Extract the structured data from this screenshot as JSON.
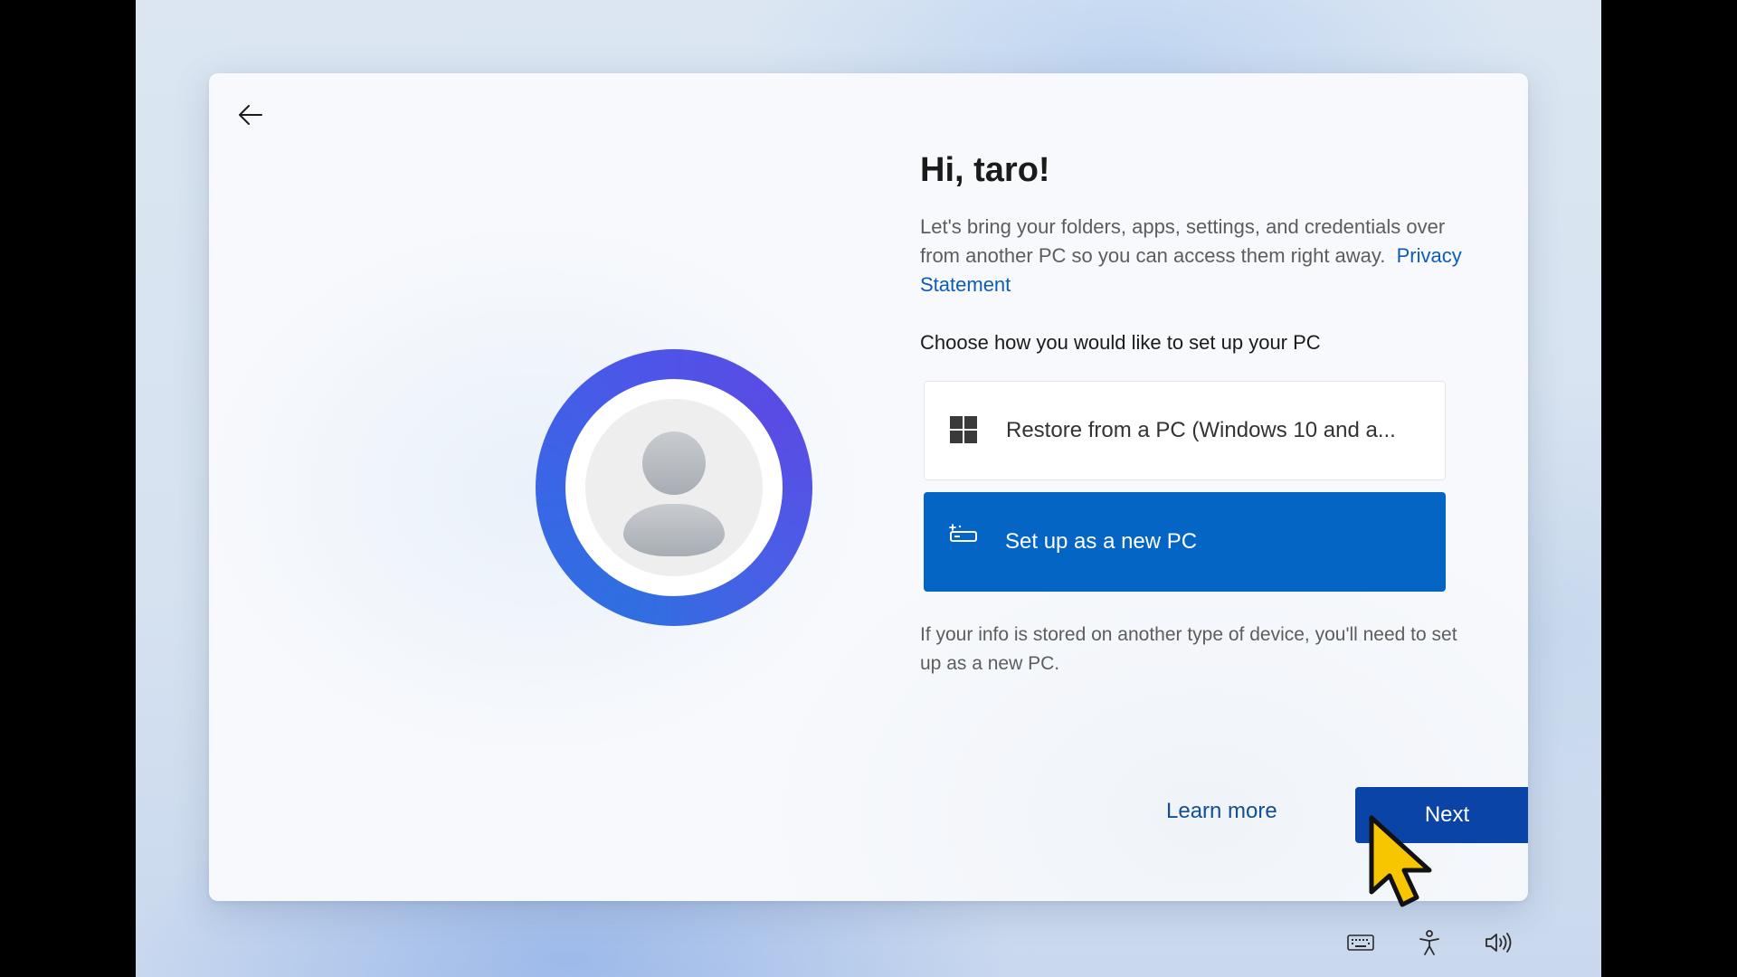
{
  "setup": {
    "greeting": "Hi, taro!",
    "description": "Let's bring your folders, apps, settings, and credentials over from another PC so you can access them right away.",
    "privacy_link": "Privacy Statement",
    "choose_prompt": "Choose how you would like to set up your PC",
    "options": [
      {
        "label": "Restore from a PC (Windows 10 and a...",
        "icon": "windows-logo-icon",
        "selected": false
      },
      {
        "label": "Set up as a new PC",
        "icon": "new-pc-icon",
        "selected": true
      }
    ],
    "info_text": "If your info is stored on another type of device, you'll need to set up as a new PC.",
    "learn_more": "Learn more",
    "next": "Next"
  },
  "tray": {
    "icons": [
      "keyboard-icon",
      "accessibility-icon",
      "volume-icon"
    ]
  },
  "colors": {
    "accent": "#0565c5",
    "next_button": "#0a44a7",
    "link": "#0f5bb5",
    "avatar_ring": "#3f5fe6"
  }
}
